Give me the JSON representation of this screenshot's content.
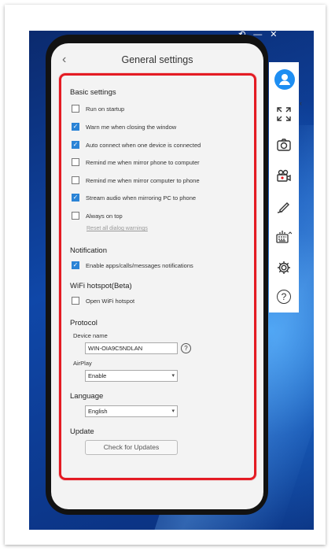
{
  "window_controls": {
    "restore": "⟲",
    "minimize": "—",
    "close": "✕"
  },
  "header": {
    "back": "‹",
    "title": "General settings"
  },
  "basic": {
    "heading": "Basic settings",
    "options": [
      {
        "label": "Run on startup",
        "checked": false
      },
      {
        "label": "Warn me when closing the window",
        "checked": true
      },
      {
        "label": "Auto connect when one device is connected",
        "checked": true
      },
      {
        "label": "Remind me when mirror phone to computer",
        "checked": false
      },
      {
        "label": "Remind me when mirror computer to phone",
        "checked": false
      },
      {
        "label": "Stream audio when mirroring PC to phone",
        "checked": true
      },
      {
        "label": "Always on top",
        "checked": false
      }
    ],
    "reset_link": "Reset all dialog warnings"
  },
  "notification": {
    "heading": "Notification",
    "option": {
      "label": "Enable apps/calls/messages notifications",
      "checked": true
    }
  },
  "wifi": {
    "heading": "WiFi hotspot(Beta)",
    "option": {
      "label": "Open WiFi hotspot",
      "checked": false
    }
  },
  "protocol": {
    "heading": "Protocol",
    "device_name_label": "Device name",
    "device_name_value": "WIN-OIA9C5NDLAN",
    "help": "?",
    "airplay_label": "AirPlay",
    "airplay_value": "Enable"
  },
  "language": {
    "heading": "Language",
    "value": "English"
  },
  "update": {
    "heading": "Update",
    "button": "Check for Updates"
  },
  "sidebar": {
    "icons": [
      "profile-icon",
      "fullscreen-icon",
      "screenshot-icon",
      "record-icon",
      "whiteboard-icon",
      "keyboard-icon",
      "settings-icon",
      "help-icon"
    ],
    "help_glyph": "?",
    "collapse": "‹"
  },
  "colors": {
    "accent": "#2a83d6",
    "highlight": "#e41b23",
    "avatar": "#1e8ef2"
  }
}
